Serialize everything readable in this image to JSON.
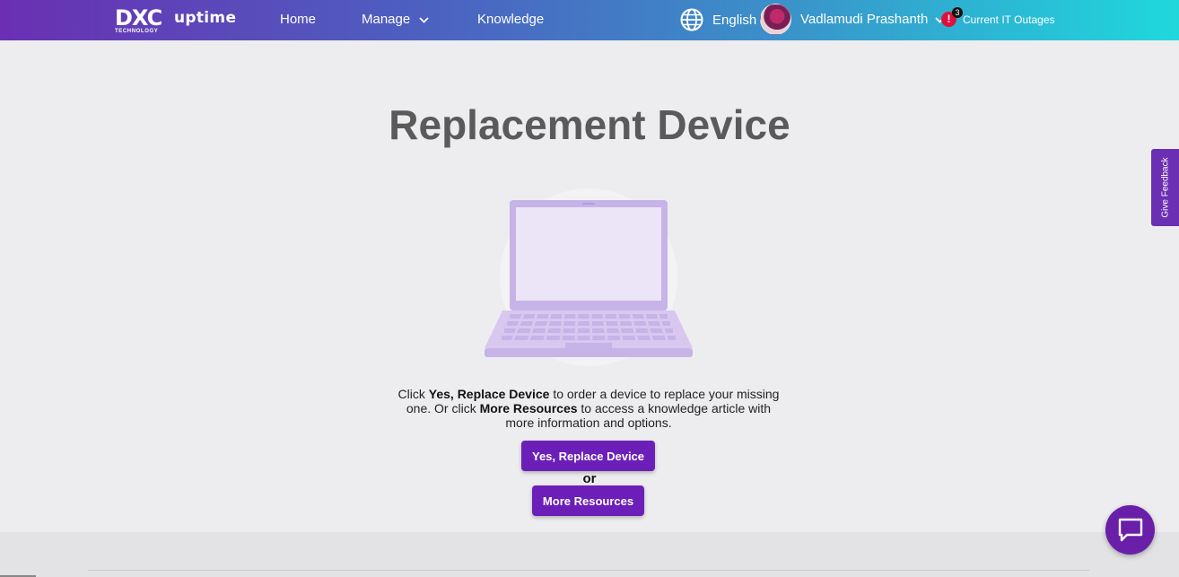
{
  "header": {
    "logo": {
      "brand": "DXC",
      "sub": "TECHNOLOGY",
      "product": "uptime"
    },
    "nav": [
      {
        "label": "Home"
      },
      {
        "label": "Manage"
      },
      {
        "label": "Knowledge"
      }
    ],
    "language": "English",
    "user_name": "Vadlamudi Prashanth",
    "alert_icon": "!",
    "outage_count": "3",
    "outages_label": "Current IT Outages"
  },
  "main": {
    "title": "Replacement Device",
    "description": {
      "part1": "Click ",
      "bold1": "Yes, Replace Device",
      "part2": " to order a device to replace your missing one. Or click ",
      "bold2": "More Resources",
      "part3": " to access a knowledge article with more information and options."
    },
    "primary_button": "Yes, Replace Device",
    "or_text": "or",
    "secondary_button": "More Resources"
  },
  "feedback_tab": "Give Feedback",
  "colors": {
    "accent": "#6c1fb8",
    "header_start": "#6a2fb3",
    "header_end": "#1fd8dc",
    "alert": "#e0103a"
  },
  "icons": [
    "globe-icon",
    "chevron-down-icon",
    "alert-icon",
    "laptop-illustration",
    "chat-icon"
  ]
}
